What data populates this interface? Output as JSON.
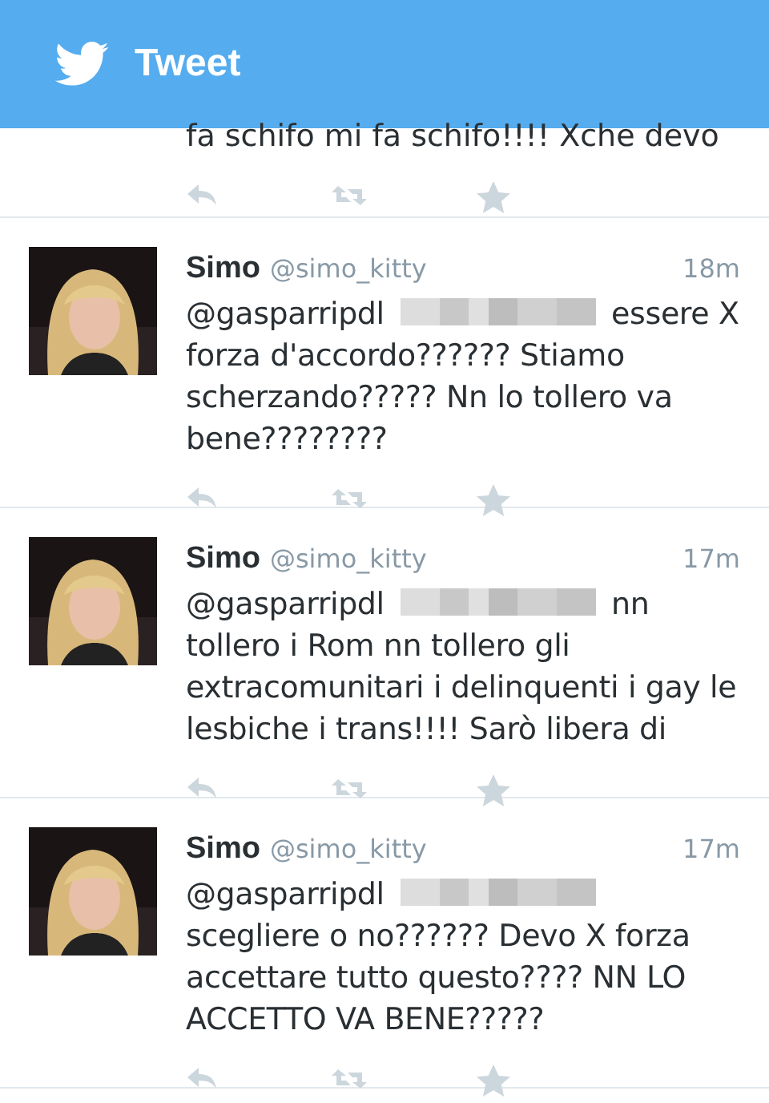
{
  "header": {
    "title": "Tweet"
  },
  "partial_tweet": {
    "text": "fa schifo mi fa schifo!!!! Xche devo"
  },
  "tweets": [
    {
      "name": "Simo",
      "handle": "@simo_kitty",
      "time": "18m",
      "mention": "@gasparripdl",
      "text": "essere X forza d'accordo?????? Stiamo scherzando????? Nn lo tollero va bene????????"
    },
    {
      "name": "Simo",
      "handle": "@simo_kitty",
      "time": "17m",
      "mention": "@gasparripdl",
      "text": "nn tollero i Rom nn tollero gli extracomunitari i delinquenti i gay le lesbiche i trans!!!! Sarò libera di"
    },
    {
      "name": "Simo",
      "handle": "@simo_kitty",
      "time": "17m",
      "mention": "@gasparripdl",
      "text": "scegliere o no?????? Devo X forza accettare tutto questo???? NN LO ACCETTO VA BENE?????"
    }
  ]
}
